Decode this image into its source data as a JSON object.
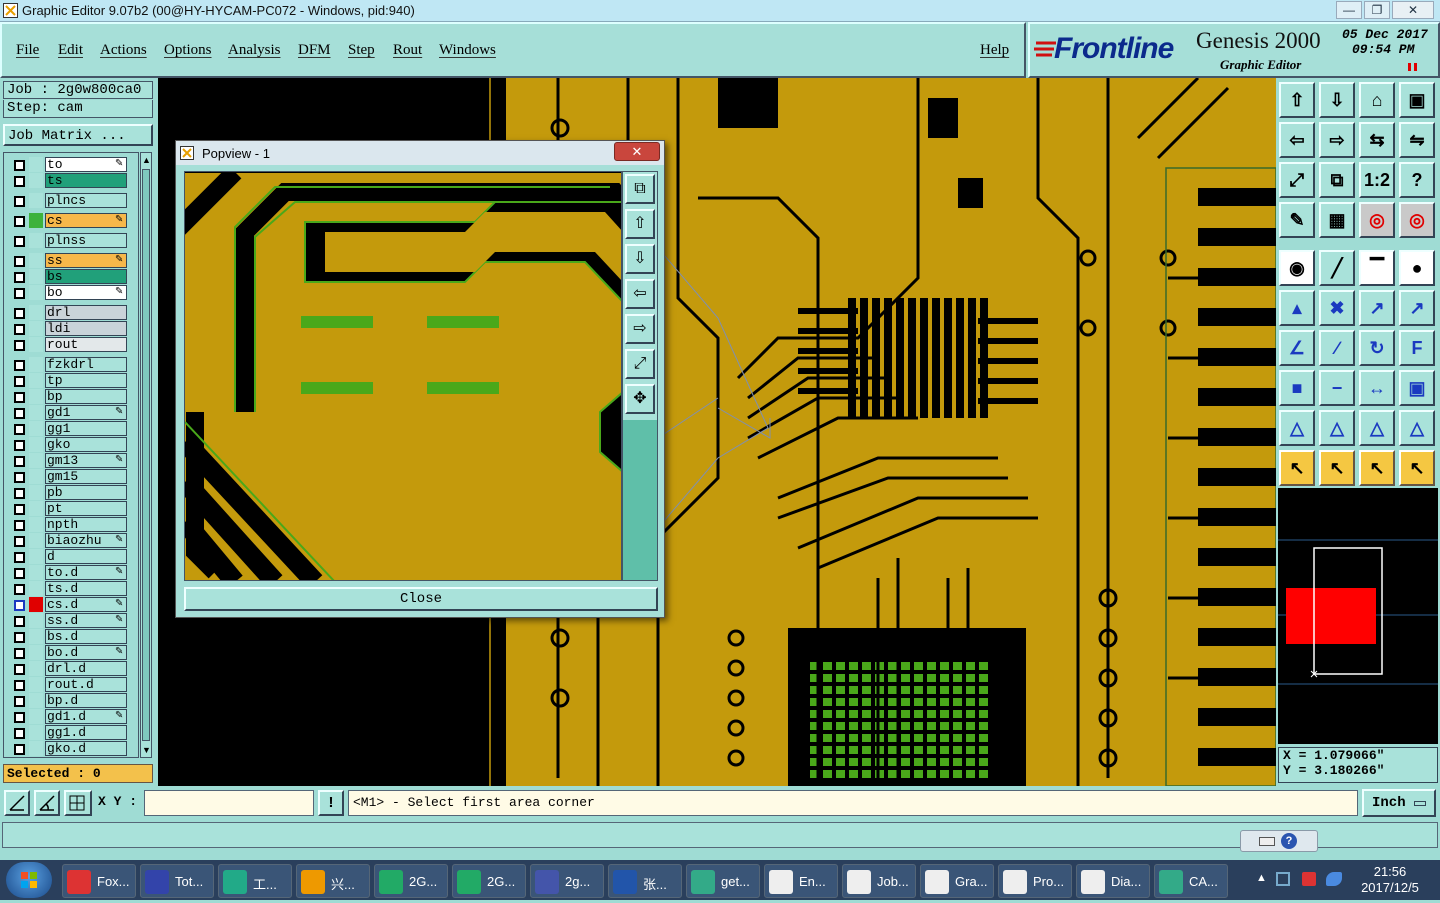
{
  "window": {
    "title": "Graphic Editor 9.07b2 (00@HY-HYCAM-PC072 - Windows, pid:940)"
  },
  "menu": {
    "items": [
      "File",
      "Edit",
      "Actions",
      "Options",
      "Analysis",
      "DFM",
      "Step",
      "Rout",
      "Windows"
    ],
    "help": "Help"
  },
  "brand": {
    "logo": "Frontline",
    "product": "Genesis 2000",
    "subtitle": "Graphic Editor",
    "date": "05 Dec 2017",
    "time": "09:54 PM"
  },
  "job": {
    "job_label": "Job : 2g0w800ca0",
    "step_label": "Step: cam",
    "matrix_button": "Job Matrix ..."
  },
  "layers": [
    {
      "name": "to",
      "color": "#ffffff",
      "edit": true
    },
    {
      "name": "ts",
      "color": "#21a07a",
      "edit": false
    },
    {
      "name": "plncs",
      "color": "#a9e2da",
      "edit": false
    },
    {
      "name": "cs",
      "color": "#f7b84a",
      "edit": true,
      "marker": "#3db23d"
    },
    {
      "name": "plnss",
      "color": "#a9e2da",
      "edit": false
    },
    {
      "name": "ss",
      "color": "#f7b84a",
      "edit": true
    },
    {
      "name": "bs",
      "color": "#21a07a",
      "edit": false
    },
    {
      "name": "bo",
      "color": "#ffffff",
      "edit": true
    },
    {
      "name": "drl",
      "color": "#c9d3d9",
      "edit": false
    },
    {
      "name": "ldi",
      "color": "#c9d3d9",
      "edit": false
    },
    {
      "name": "rout",
      "color": "#e3e8ea",
      "edit": false
    },
    {
      "name": "fzkdrl",
      "color": "#a9e2da",
      "edit": false
    },
    {
      "name": "tp",
      "color": "#a9e2da",
      "edit": false
    },
    {
      "name": "bp",
      "color": "#a9e2da",
      "edit": false
    },
    {
      "name": "gd1",
      "color": "#a9e2da",
      "edit": true
    },
    {
      "name": "gg1",
      "color": "#a9e2da",
      "edit": false
    },
    {
      "name": "gko",
      "color": "#a9e2da",
      "edit": false
    },
    {
      "name": "gm13",
      "color": "#a9e2da",
      "edit": true
    },
    {
      "name": "gm15",
      "color": "#a9e2da",
      "edit": false
    },
    {
      "name": "pb",
      "color": "#a9e2da",
      "edit": false
    },
    {
      "name": "pt",
      "color": "#a9e2da",
      "edit": false
    },
    {
      "name": "npth",
      "color": "#a9e2da",
      "edit": false
    },
    {
      "name": "biaozhu",
      "color": "#a9e2da",
      "edit": true
    },
    {
      "name": "d",
      "color": "#a9e2da",
      "edit": false
    },
    {
      "name": "to.d",
      "color": "#a9e2da",
      "edit": true
    },
    {
      "name": "ts.d",
      "color": "#a9e2da",
      "edit": false
    },
    {
      "name": "cs.d",
      "color": "#a9e2da",
      "edit": true,
      "marker": "#e00000",
      "active": true
    },
    {
      "name": "ss.d",
      "color": "#a9e2da",
      "edit": true
    },
    {
      "name": "bs.d",
      "color": "#a9e2da",
      "edit": false
    },
    {
      "name": "bo.d",
      "color": "#a9e2da",
      "edit": true
    },
    {
      "name": "drl.d",
      "color": "#a9e2da",
      "edit": false
    },
    {
      "name": "rout.d",
      "color": "#a9e2da",
      "edit": false
    },
    {
      "name": "bp.d",
      "color": "#a9e2da",
      "edit": false
    },
    {
      "name": "gd1.d",
      "color": "#a9e2da",
      "edit": true
    },
    {
      "name": "gg1.d",
      "color": "#a9e2da",
      "edit": false
    },
    {
      "name": "gko.d",
      "color": "#a9e2da",
      "edit": false
    }
  ],
  "selected": "Selected : 0",
  "popview": {
    "title": "Popview - 1",
    "close_label": "Close"
  },
  "coords": {
    "x": "X = 1.079066\"",
    "y": "Y = 3.180266\""
  },
  "status": {
    "xy_label": "X Y :",
    "xy_value": "",
    "message": "<M1> - Select first area corner",
    "unit": "Inch"
  },
  "taskbar": {
    "items": [
      "Fox...",
      "Tot...",
      "工...",
      "兴...",
      "2G...",
      "2G...",
      "2g...",
      "张...",
      "get...",
      "En...",
      "Job...",
      "Gra...",
      "Pro...",
      "Dia...",
      "CA..."
    ],
    "clock_time": "21:56",
    "clock_date": "2017/12/5"
  },
  "colors": {
    "board": "#c49a0c",
    "copper_dark": "#000000",
    "pad_green": "#4aa81a",
    "selection": "#ff0000"
  }
}
